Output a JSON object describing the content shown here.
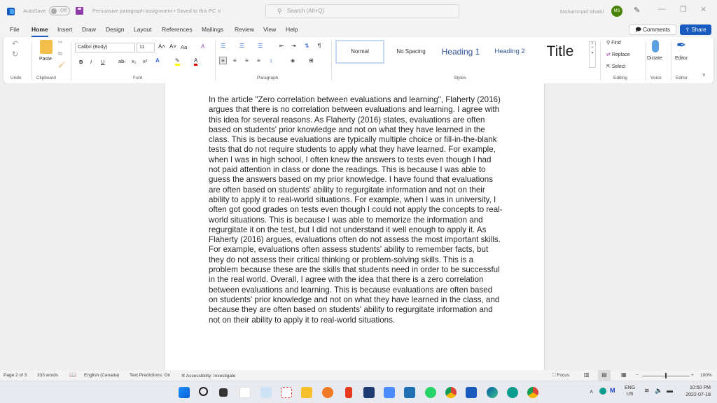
{
  "titlebar": {
    "autosave_label": "AutoSave",
    "autosave_state": "Off",
    "document_title": "Persuasive paragraph assignment • Saved to this PC ∨",
    "search_placeholder": "Search (Alt+Q)",
    "user_name": "Mohammad Shakil",
    "user_initials": "MS",
    "minimize": "—",
    "restore": "❐",
    "close": "✕"
  },
  "tabs": [
    "File",
    "Home",
    "Insert",
    "Draw",
    "Design",
    "Layout",
    "References",
    "Mailings",
    "Review",
    "View",
    "Help"
  ],
  "active_tab": "Home",
  "actions": {
    "comments": "Comments",
    "share": "Share"
  },
  "ribbon": {
    "undo": {
      "label": "Undo"
    },
    "clipboard": {
      "label": "Clipboard",
      "paste": "Paste"
    },
    "font": {
      "label": "Font",
      "font_name": "Calibri (Body)",
      "font_size": "11",
      "bold": "B",
      "italic": "I",
      "underline": "U",
      "change_case": "Aa"
    },
    "paragraph": {
      "label": "Paragraph"
    },
    "styles": {
      "label": "Styles",
      "items": [
        "Normal",
        "No Spacing",
        "Heading 1",
        "Heading 2",
        "Title"
      ],
      "selected": "Normal"
    },
    "editing": {
      "label": "Editing",
      "find": "Find",
      "replace": "Replace",
      "select": "Select"
    },
    "voice": {
      "label": "Voice",
      "dictate": "Dictate"
    },
    "editor": {
      "label": "Editor",
      "editor_button": "Editor"
    }
  },
  "document": {
    "text": "In the article \"Zero correlation between evaluations and learning\", Flaherty (2016) argues that there is no correlation between evaluations and learning. I agree with this idea for several reasons. As Flaherty (2016) states, evaluations are often based on students' prior knowledge and not on what they have learned in the class. This is because evaluations are typically multiple choice or fill-in-the-blank tests that do not require students to apply what they have learned. For example, when I was in high school, I often knew the answers to tests even though I had not paid attention in class or done the readings. This is because I was able to guess the answers based on my prior knowledge. I have found that evaluations are often based on students' ability to regurgitate information and not on their ability to apply it to real-world situations. For example, when I was in university, I often got good grades on tests even though I could not apply the concepts to real-world situations. This is because I was able to memorize the information and regurgitate it on the test, but I did not understand it well enough to apply it. As Flaherty (2016) argues, evaluations often do not assess the most important skills. For example, evaluations often assess students' ability to remember facts, but they do not assess their critical thinking or problem-solving skills. This is a problem because these are the skills that students need in order to be successful in the real world. Overall, I agree with the idea that there is a zero correlation between evaluations and learning. This is because evaluations are often based on students' prior knowledge and not on what they have learned in the class, and because they are often based on students' ability to regurgitate information and not on their ability to apply it to real-world situations."
  },
  "statusbar": {
    "page": "Page 2 of 3",
    "words": "333 words",
    "language": "English (Canada)",
    "text_predictions": "Text Predictions: On",
    "accessibility": "Accessibility: Investigate",
    "focus": "Focus",
    "zoom_minus": "−",
    "zoom_plus": "+",
    "zoom_level": "100%"
  },
  "taskbar": {
    "apps": [
      "start",
      "search",
      "task-view",
      "itunes",
      "photos",
      "snipping-tool",
      "file-explorer",
      "firefox",
      "office",
      "microsoft-store",
      "zoom",
      "mail",
      "whatsapp",
      "chrome",
      "word",
      "edge",
      "eset",
      "chrome-2"
    ],
    "language_top": "ENG",
    "language_bottom": "US",
    "time": "10:50 PM",
    "date": "2022-07-18"
  },
  "colors": {
    "accent": "#185abd",
    "avatar": "#498205"
  }
}
